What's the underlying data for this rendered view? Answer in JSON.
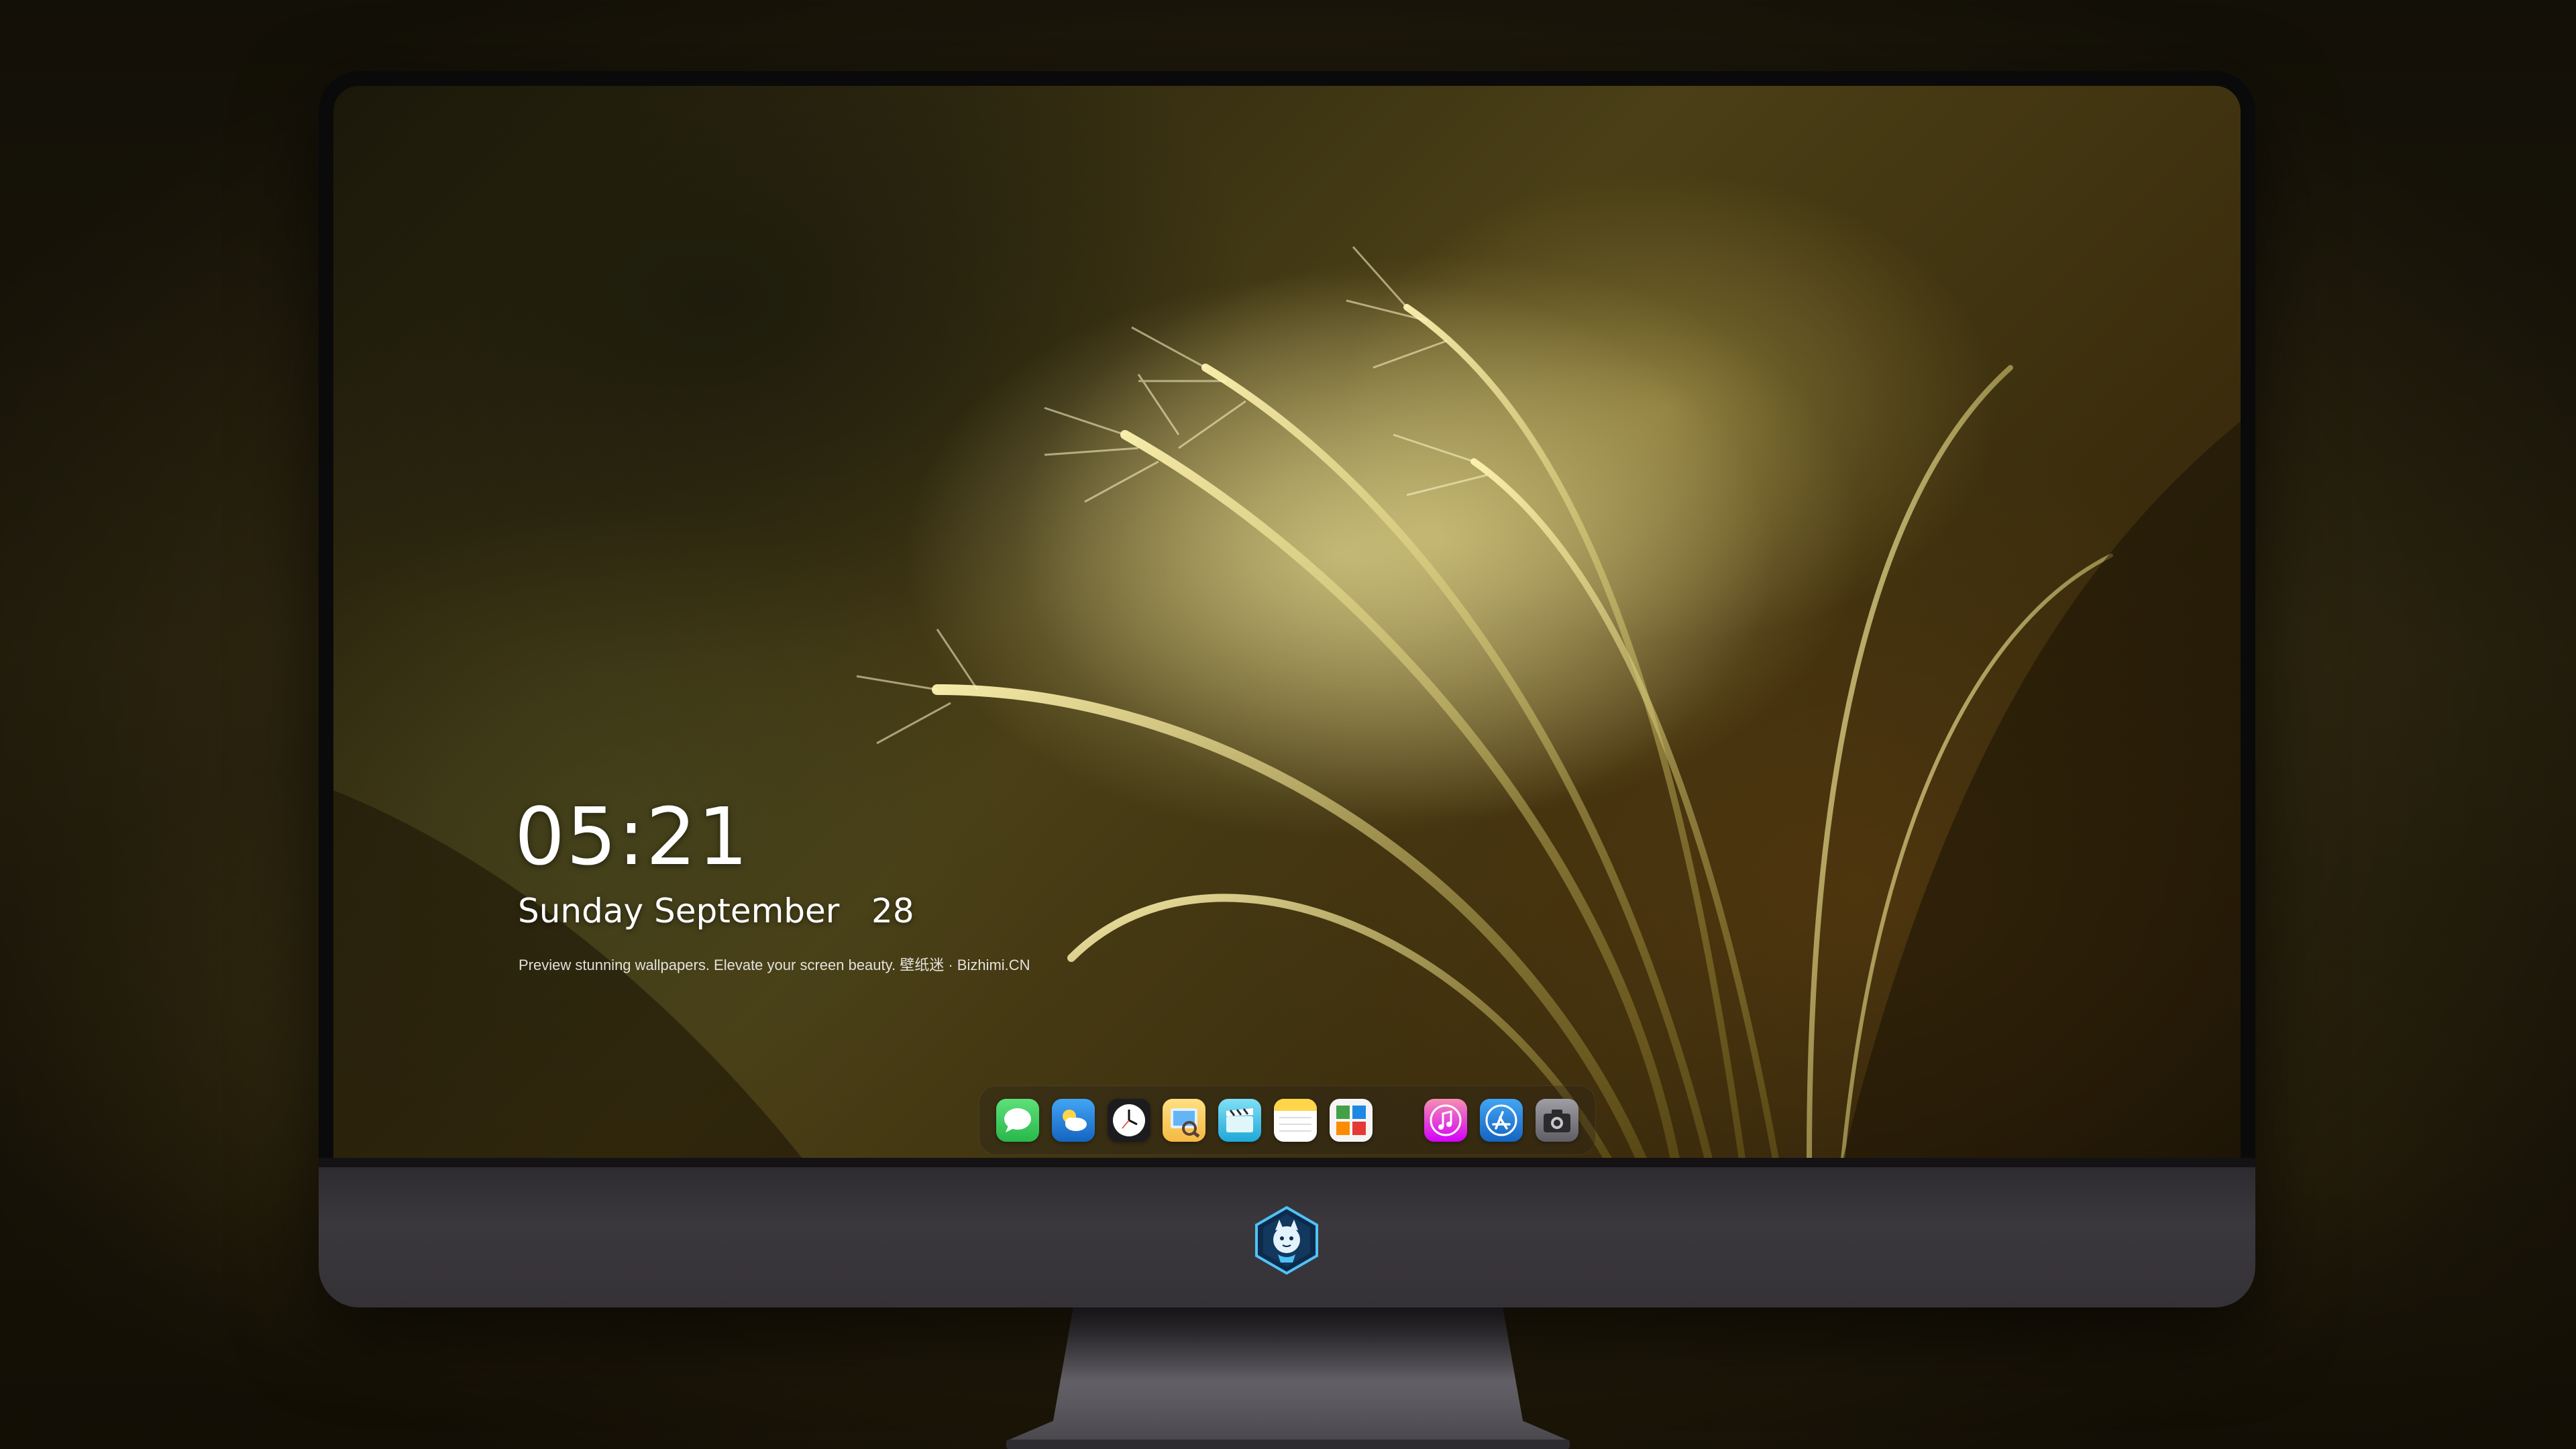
{
  "lock_screen": {
    "time": "05:21",
    "date": "Sunday September   28",
    "tagline": "Preview stunning wallpapers. Elevate your screen beauty. 壁纸迷 · Bizhimi.CN"
  },
  "dock": {
    "apps": [
      {
        "name": "messages",
        "icon": "messages-icon",
        "color": "#34c759"
      },
      {
        "name": "weather",
        "icon": "weather-icon",
        "color": "#1e88e5"
      },
      {
        "name": "clock",
        "icon": "clock-icon",
        "color": "#1c1c1e"
      },
      {
        "name": "preview",
        "icon": "preview-icon",
        "color": "#f5c542"
      },
      {
        "name": "clips",
        "icon": "clips-icon",
        "color": "#35c0e8"
      },
      {
        "name": "notes",
        "icon": "notes-icon",
        "color": "#ffd54a"
      },
      {
        "name": "photo-booth",
        "icon": "photo-booth-icon",
        "color": "#e5e5e5"
      },
      {
        "name": "music",
        "icon": "music-icon",
        "color": "#e040fb"
      },
      {
        "name": "app-store",
        "icon": "app-store-icon",
        "color": "#1e88ff"
      },
      {
        "name": "camera",
        "icon": "camera-icon",
        "color": "#6e6e73"
      }
    ]
  },
  "brand": {
    "logo": "mascot-logo-icon"
  },
  "colors": {
    "wallpaper_accent": "#c8b45a",
    "monitor_chin": "#3a373c",
    "dock_bg": "#2a2419"
  }
}
